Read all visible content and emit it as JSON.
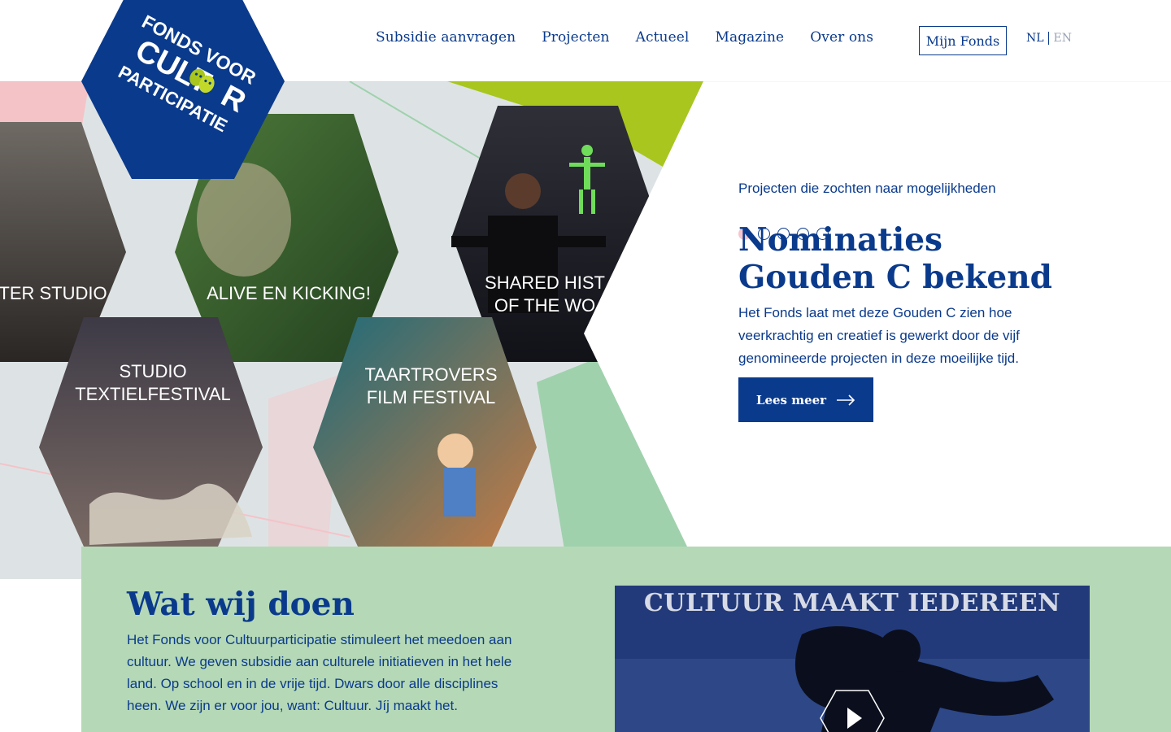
{
  "logo": {
    "line1": "FONDS VOOR",
    "line2": "CULT",
    "line3": "R",
    "line4": "PARTICIPATIE"
  },
  "nav": {
    "items": [
      "Subsidie aanvragen",
      "Projecten",
      "Actueel",
      "Magazine",
      "Over ons"
    ],
    "account": "Mijn Fonds",
    "lang_nl": "NL",
    "lang_en": "EN"
  },
  "hero": {
    "tiles": [
      "TER STUDIO",
      "ALIVE EN KICKING!",
      "SHARED HIST",
      "OF THE WO",
      "STUDIO",
      "TEXTIELFESTIVAL",
      "TAARTROVERS",
      "FILM FESTIVAL"
    ],
    "slides_total": 5,
    "slide_active": 1,
    "kicker": "Projecten die zochten naar mogelijkheden",
    "title": "Nominaties Gouden C bekend",
    "text": "Het Fonds laat met deze Gouden C zien hoe veerkrachtig en creatief is gewerkt door de vijf genomineerde projecten in deze moeilijke tijd.",
    "button": "Lees meer"
  },
  "about": {
    "title": "Wat wij doen",
    "text": "Het Fonds voor Cultuurparticipatie stimuleert het meedoen aan cultuur. We geven subsidie aan culturele initiatieven in het hele land. Op school en in de vrije tijd. Dwars door alle disciplines heen. We zijn er voor jou, want: Cultuur. Jíj maakt het.",
    "video_title": "CULTUUR MAAKT IEDEREEN"
  },
  "colors": {
    "brand_blue": "#0a3a8c",
    "lime": "#a8c61e",
    "mint": "#b5d9b6",
    "pink": "#f7c5cb"
  }
}
